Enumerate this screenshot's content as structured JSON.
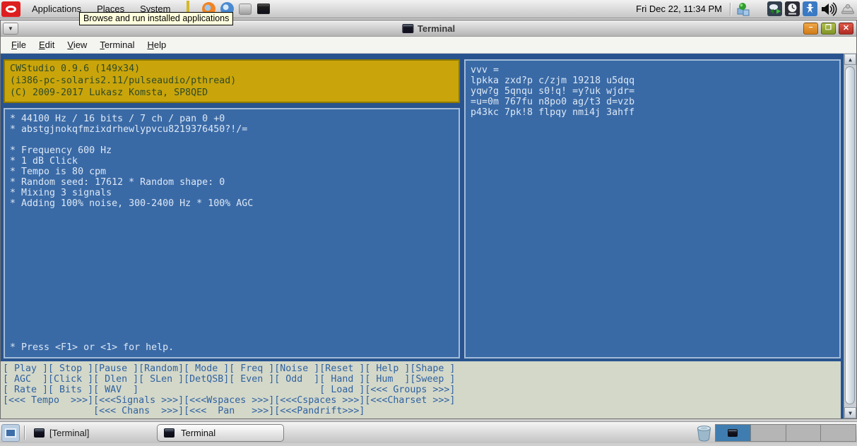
{
  "desktop": {
    "top_panel": {
      "menus": [
        "Applications",
        "Places",
        "System"
      ],
      "launcher_icons": [
        "install-diamond",
        "firefox",
        "thunderbird",
        "file-manager",
        "terminal"
      ],
      "tooltip": "Browse and run installed applications",
      "clock": "Fri Dec 22, 11:34 PM",
      "tray_icons": [
        "software-update",
        "network",
        "clock",
        "accessibility",
        "volume",
        "input-method"
      ]
    },
    "taskbar": {
      "window_list": [
        {
          "label": "[Terminal]",
          "state": "minimized"
        },
        {
          "label": "Terminal",
          "state": "active"
        }
      ],
      "workspaces": {
        "count": 4,
        "active": 1
      }
    }
  },
  "window": {
    "title": "Terminal",
    "menubar": [
      "File",
      "Edit",
      "View",
      "Terminal",
      "Help"
    ],
    "controls": {
      "minimize": "−",
      "maximize": "❐",
      "close": "✕"
    }
  },
  "cwstudio": {
    "header": [
      "CWStudio 0.9.6 (149x34)",
      "(i386-pc-solaris2.11/pulseaudio/pthread)",
      "(C) 2009-2017 Lukasz Komsta, SP8QED"
    ],
    "status_lines": [
      "* 44100 Hz / 16 bits / 7 ch / pan 0 +0",
      "* abstgjnokqfmzixdrhewlypvcu8219376450?!/=",
      "",
      "* Frequency 600 Hz",
      "* 1 dB Click",
      "* Tempo is 80 cpm",
      "* Random seed: 17612 * Random shape: 0",
      "* Mixing 3 signals",
      "* Adding 100% noise, 300-2400 Hz * 100% AGC"
    ],
    "help_line": "* Press <F1> or <1> for help.",
    "output_lines": [
      "vvv =",
      "lpkka zxd?p c/zjm 19218 u5dqq",
      "yqw?g 5qnqu s0!q! =y?uk wjdr=",
      "=u=0m 767fu n8po0 ag/t3 d=vzb",
      "p43kc 7pk!8 flpqy nmi4j 3ahff"
    ],
    "menu_rows": [
      "[ Play ][ Stop ][Pause ][Random][ Mode ][ Freq ][Noise ][Reset ][ Help ][Shape ]",
      "[ AGC  ][Click ][ Dlen ][ SLen ][DetQSB][ Even ][ Odd  ][ Hand ][ Hum  ][Sweep ]",
      "[ Rate ][ Bits ][ WAV  ]                                [ Load ][<<< Groups >>>]",
      "[<<< Tempo  >>>][<<<Signals >>>][<<<Wspaces >>>][<<<Cspaces >>>][<<<Charset >>>]",
      "                [<<< Chans  >>>][<<<  Pan   >>>][<<<Pandrift>>>]"
    ]
  },
  "colors": {
    "terminal_bg": "#28538e",
    "panel_bg": "#3a6aa6",
    "panel_border": "#a3bcd8",
    "panel_text": "#dce8f6",
    "header_bg": "#c9a50b",
    "header_border": "#8f7a00",
    "header_text": "#2f4a28",
    "menu_area_bg": "#d4d8c9",
    "menu_text": "#2f62a0",
    "workspace_active": "#3f7db0"
  }
}
